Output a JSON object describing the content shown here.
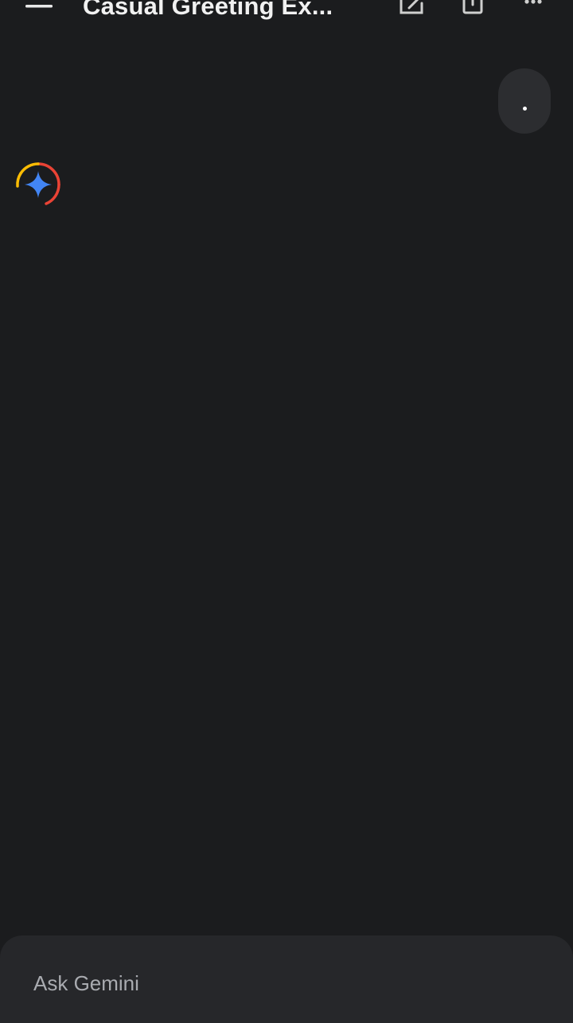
{
  "header": {
    "title": "Casual Greeting Ex...",
    "menu_icon": "menu-icon",
    "edit_icon": "edit-icon",
    "share_icon": "share-icon",
    "more_icon": "more-vertical-icon"
  },
  "conversation": {
    "user_message": ".",
    "assistant_avatar_icon": "gemini-sparkle-icon"
  },
  "composer": {
    "placeholder": "Ask Gemini"
  },
  "colors": {
    "background": "#1b1c1e",
    "bubble": "#2c2d30",
    "composer": "#26272a",
    "sparkle_blue": "#4285f4"
  }
}
